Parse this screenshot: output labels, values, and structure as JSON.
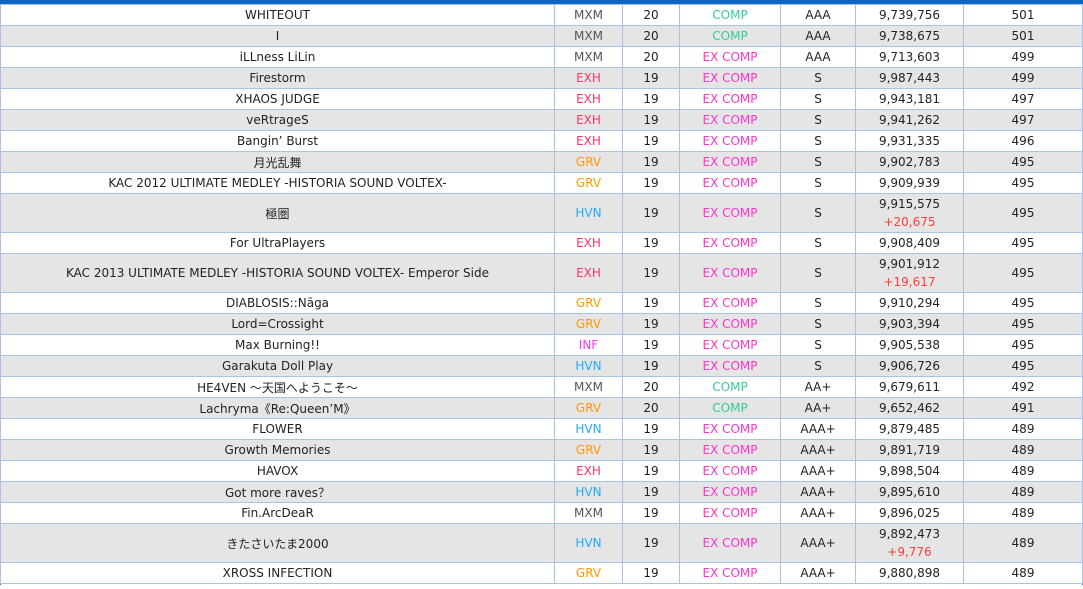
{
  "level_colors": {
    "MXM": "#555555",
    "EXH": "#ff3366",
    "GRV": "#ff9900",
    "HVN": "#22aaff",
    "INF": "#ff33ff"
  },
  "lamp_colors": {
    "COMP": "#33cc99",
    "EX COMP": "#ff33cc"
  },
  "rows": [
    {
      "title": "WHITEOUT",
      "level": "MXM",
      "diff": "20",
      "lamp": "COMP",
      "grade": "AAA",
      "score": "9,739,756",
      "delta": "",
      "volforce": "501"
    },
    {
      "title": "I",
      "level": "MXM",
      "diff": "20",
      "lamp": "COMP",
      "grade": "AAA",
      "score": "9,738,675",
      "delta": "",
      "volforce": "501"
    },
    {
      "title": "iLLness LiLin",
      "level": "MXM",
      "diff": "20",
      "lamp": "EX COMP",
      "grade": "AAA",
      "score": "9,713,603",
      "delta": "",
      "volforce": "499"
    },
    {
      "title": "Firestorm",
      "level": "EXH",
      "diff": "19",
      "lamp": "EX COMP",
      "grade": "S",
      "score": "9,987,443",
      "delta": "",
      "volforce": "499"
    },
    {
      "title": "XHAOS JUDGE",
      "level": "EXH",
      "diff": "19",
      "lamp": "EX COMP",
      "grade": "S",
      "score": "9,943,181",
      "delta": "",
      "volforce": "497"
    },
    {
      "title": "veRtrageS",
      "level": "EXH",
      "diff": "19",
      "lamp": "EX COMP",
      "grade": "S",
      "score": "9,941,262",
      "delta": "",
      "volforce": "497"
    },
    {
      "title": "Bangin’ Burst",
      "level": "EXH",
      "diff": "19",
      "lamp": "EX COMP",
      "grade": "S",
      "score": "9,931,335",
      "delta": "",
      "volforce": "496"
    },
    {
      "title": "月光乱舞",
      "level": "GRV",
      "diff": "19",
      "lamp": "EX COMP",
      "grade": "S",
      "score": "9,902,783",
      "delta": "",
      "volforce": "495"
    },
    {
      "title": "KAC 2012 ULTIMATE MEDLEY -HISTORIA SOUND VOLTEX-",
      "level": "GRV",
      "diff": "19",
      "lamp": "EX COMP",
      "grade": "S",
      "score": "9,909,939",
      "delta": "",
      "volforce": "495"
    },
    {
      "title": "極圏",
      "level": "HVN",
      "diff": "19",
      "lamp": "EX COMP",
      "grade": "S",
      "score": "9,915,575",
      "delta": "+20,675",
      "volforce": "495"
    },
    {
      "title": "For UltraPlayers",
      "level": "EXH",
      "diff": "19",
      "lamp": "EX COMP",
      "grade": "S",
      "score": "9,908,409",
      "delta": "",
      "volforce": "495"
    },
    {
      "title": "KAC 2013 ULTIMATE MEDLEY -HISTORIA SOUND VOLTEX- Emperor Side",
      "level": "EXH",
      "diff": "19",
      "lamp": "EX COMP",
      "grade": "S",
      "score": "9,901,912",
      "delta": "+19,617",
      "volforce": "495"
    },
    {
      "title": "DIABLOSIS::Nāga",
      "level": "GRV",
      "diff": "19",
      "lamp": "EX COMP",
      "grade": "S",
      "score": "9,910,294",
      "delta": "",
      "volforce": "495"
    },
    {
      "title": "Lord=Crossight",
      "level": "GRV",
      "diff": "19",
      "lamp": "EX COMP",
      "grade": "S",
      "score": "9,903,394",
      "delta": "",
      "volforce": "495"
    },
    {
      "title": "Max Burning!!",
      "level": "INF",
      "diff": "19",
      "lamp": "EX COMP",
      "grade": "S",
      "score": "9,905,538",
      "delta": "",
      "volforce": "495"
    },
    {
      "title": "Garakuta Doll Play",
      "level": "HVN",
      "diff": "19",
      "lamp": "EX COMP",
      "grade": "S",
      "score": "9,906,726",
      "delta": "",
      "volforce": "495"
    },
    {
      "title": "HE4VEN ～天国へようこそ～",
      "level": "MXM",
      "diff": "20",
      "lamp": "COMP",
      "grade": "AA+",
      "score": "9,679,611",
      "delta": "",
      "volforce": "492"
    },
    {
      "title": "Lachryma《Re:Queen’M》",
      "level": "GRV",
      "diff": "20",
      "lamp": "COMP",
      "grade": "AA+",
      "score": "9,652,462",
      "delta": "",
      "volforce": "491"
    },
    {
      "title": "FLOWER",
      "level": "HVN",
      "diff": "19",
      "lamp": "EX COMP",
      "grade": "AAA+",
      "score": "9,879,485",
      "delta": "",
      "volforce": "489"
    },
    {
      "title": "Growth Memories",
      "level": "GRV",
      "diff": "19",
      "lamp": "EX COMP",
      "grade": "AAA+",
      "score": "9,891,719",
      "delta": "",
      "volforce": "489"
    },
    {
      "title": "HAVOX",
      "level": "EXH",
      "diff": "19",
      "lamp": "EX COMP",
      "grade": "AAA+",
      "score": "9,898,504",
      "delta": "",
      "volforce": "489"
    },
    {
      "title": "Got more raves？",
      "level": "HVN",
      "diff": "19",
      "lamp": "EX COMP",
      "grade": "AAA+",
      "score": "9,895,610",
      "delta": "",
      "volforce": "489"
    },
    {
      "title": "Fin.ArcDeaR",
      "level": "MXM",
      "diff": "19",
      "lamp": "EX COMP",
      "grade": "AAA+",
      "score": "9,896,025",
      "delta": "",
      "volforce": "489"
    },
    {
      "title": "きたさいたま2000",
      "level": "HVN",
      "diff": "19",
      "lamp": "EX COMP",
      "grade": "AAA+",
      "score": "9,892,473",
      "delta": "+9,776",
      "volforce": "489"
    },
    {
      "title": "XROSS INFECTION",
      "level": "GRV",
      "diff": "19",
      "lamp": "EX COMP",
      "grade": "AAA+",
      "score": "9,880,898",
      "delta": "",
      "volforce": "489"
    }
  ]
}
